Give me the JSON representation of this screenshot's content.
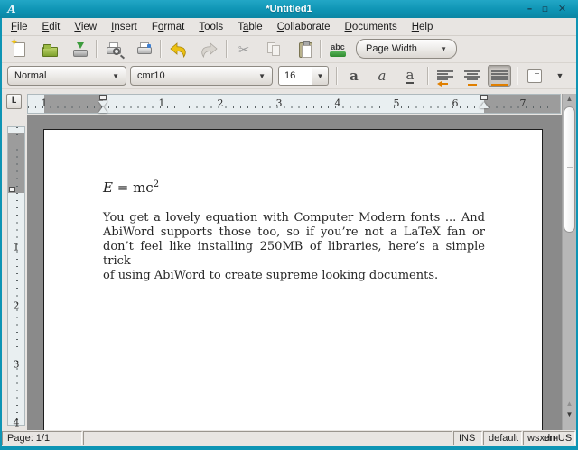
{
  "window": {
    "title": "*Untitled1",
    "app_icon": "A",
    "controls": {
      "minimize": "–",
      "maximize": "▫",
      "close": "✕"
    }
  },
  "menu": {
    "items": [
      {
        "label": "File",
        "mnemonic_index": 0
      },
      {
        "label": "Edit",
        "mnemonic_index": 0
      },
      {
        "label": "View",
        "mnemonic_index": 0
      },
      {
        "label": "Insert",
        "mnemonic_index": 0
      },
      {
        "label": "Format",
        "mnemonic_index": 1
      },
      {
        "label": "Tools",
        "mnemonic_index": 0
      },
      {
        "label": "Table",
        "mnemonic_index": 1
      },
      {
        "label": "Collaborate",
        "mnemonic_index": 0
      },
      {
        "label": "Documents",
        "mnemonic_index": 0
      },
      {
        "label": "Help",
        "mnemonic_index": 0
      }
    ]
  },
  "toolbar_top": {
    "icons": [
      "new",
      "open",
      "save",
      "print-preview",
      "print",
      "undo",
      "redo",
      "cut",
      "copy",
      "paste",
      "spellcheck"
    ],
    "disabled_icons": [
      "redo",
      "cut",
      "copy"
    ],
    "zoom_value": "Page Width",
    "spell_text": "abc"
  },
  "toolbar_format": {
    "style_value": "Normal",
    "font_value": "cmr10",
    "size_value": "16",
    "bold_glyph": "a",
    "italic_glyph": "a",
    "underline_glyph": "a",
    "align_buttons": [
      "align-left",
      "align-center",
      "align-justify"
    ],
    "active_align": "align-justify"
  },
  "ruler": {
    "tab_button": "L",
    "h_labels": [
      "1",
      "1",
      "2",
      "3",
      "4",
      "5",
      "6",
      "7"
    ],
    "v_labels": [
      "1",
      "2",
      "3",
      "4"
    ]
  },
  "document": {
    "equation": {
      "lhs": "E",
      "relation": " = ",
      "rhs_base": "mc",
      "rhs_sup": "2"
    },
    "paragraph_lines": [
      "You get a lovely equation with Computer Modern fonts ... And",
      "AbiWord supports those too, so if you’re not a LaTeX fan or",
      "don’t feel like installing 250MB of libraries, here’s a simple trick",
      "of using AbiWord to create supreme looking documents."
    ]
  },
  "status_bar": {
    "page": "Page: 1/1",
    "message": "",
    "insert_mode": "INS",
    "style": "default",
    "right_text_a": "wsxdm",
    "right_text_b": "en-US"
  },
  "colors": {
    "titlebar": "#0e94b4",
    "toolbar_bg": "#e8e5e2",
    "canvas": "#8a8a8a",
    "ruler_bg": "#e9eff1",
    "ruler_margin": "#9c9c9c",
    "accent_orange": "#e07f00",
    "undo_yellow": "#ecc113",
    "folder_green": "#8fae3c"
  }
}
